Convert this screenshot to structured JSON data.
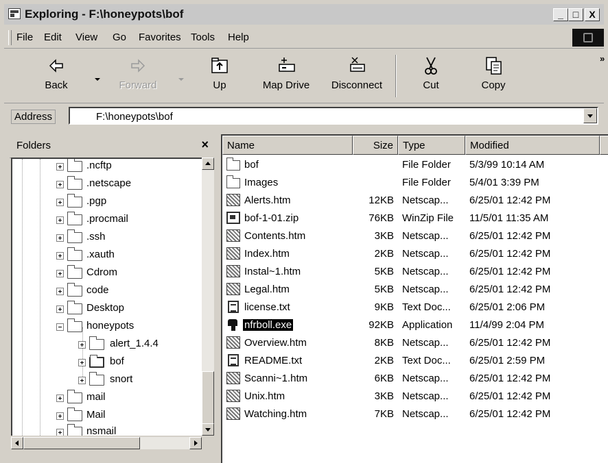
{
  "window": {
    "title": "Exploring - F:\\honeypots\\bof",
    "icon": "explorer-window-icon",
    "caption_buttons": [
      "_",
      "□",
      "X"
    ]
  },
  "menu": [
    "File",
    "Edit",
    "View",
    "Go",
    "Favorites",
    "Tools",
    "Help"
  ],
  "toolbar": {
    "back": "Back",
    "forward": "Forward",
    "up": "Up",
    "map_drive": "Map Drive",
    "disconnect": "Disconnect",
    "cut": "Cut",
    "copy": "Copy",
    "more": "»"
  },
  "address": {
    "label": "Address",
    "value": "F:\\honeypots\\bof"
  },
  "folders_pane": {
    "title": "Folders",
    "close": "×",
    "items": [
      {
        "label": ".ncftp",
        "level": 2,
        "expander": "closed"
      },
      {
        "label": ".netscape",
        "level": 2,
        "expander": "closed"
      },
      {
        "label": ".pgp",
        "level": 2,
        "expander": "closed"
      },
      {
        "label": ".procmail",
        "level": 2,
        "expander": "closed"
      },
      {
        "label": ".ssh",
        "level": 2,
        "expander": "closed"
      },
      {
        "label": ".xauth",
        "level": 2,
        "expander": "closed"
      },
      {
        "label": "Cdrom",
        "level": 2,
        "expander": "closed"
      },
      {
        "label": "code",
        "level": 2,
        "expander": "closed"
      },
      {
        "label": "Desktop",
        "level": 2,
        "expander": "closed"
      },
      {
        "label": "honeypots",
        "level": 2,
        "expander": "open"
      },
      {
        "label": "alert_1.4.4",
        "level": 3,
        "expander": "closed"
      },
      {
        "label": "bof",
        "level": 3,
        "expander": "closed"
      },
      {
        "label": "snort",
        "level": 3,
        "expander": "closed"
      },
      {
        "label": "mail",
        "level": 2,
        "expander": "closed"
      },
      {
        "label": "Mail",
        "level": 2,
        "expander": "closed"
      },
      {
        "label": "nsmail",
        "level": 2,
        "expander": "closed"
      }
    ]
  },
  "file_list": {
    "columns": [
      "Name",
      "Size",
      "Type",
      "Modified"
    ],
    "rows": [
      {
        "name": "bof",
        "size": "",
        "type": "File Folder",
        "modified": "5/3/99 10:14 AM",
        "icon": "folder"
      },
      {
        "name": "Images",
        "size": "",
        "type": "File Folder",
        "modified": "5/4/01 3:39 PM",
        "icon": "folder"
      },
      {
        "name": "Alerts.htm",
        "size": "12KB",
        "type": "Netscap...",
        "modified": "6/25/01 12:42 PM",
        "icon": "htm"
      },
      {
        "name": "bof-1-01.zip",
        "size": "76KB",
        "type": "WinZip File",
        "modified": "11/5/01 11:35 AM",
        "icon": "zip"
      },
      {
        "name": "Contents.htm",
        "size": "3KB",
        "type": "Netscap...",
        "modified": "6/25/01 12:42 PM",
        "icon": "htm"
      },
      {
        "name": "Index.htm",
        "size": "2KB",
        "type": "Netscap...",
        "modified": "6/25/01 12:42 PM",
        "icon": "htm"
      },
      {
        "name": "Instal~1.htm",
        "size": "5KB",
        "type": "Netscap...",
        "modified": "6/25/01 12:42 PM",
        "icon": "htm"
      },
      {
        "name": "Legal.htm",
        "size": "5KB",
        "type": "Netscap...",
        "modified": "6/25/01 12:42 PM",
        "icon": "htm"
      },
      {
        "name": "license.txt",
        "size": "9KB",
        "type": "Text Doc...",
        "modified": "6/25/01 2:06 PM",
        "icon": "txt"
      },
      {
        "name": "nfrboll.exe",
        "size": "92KB",
        "type": "Application",
        "modified": "11/4/99 2:04 PM",
        "icon": "exe",
        "selected": true
      },
      {
        "name": "Overview.htm",
        "size": "8KB",
        "type": "Netscap...",
        "modified": "6/25/01 12:42 PM",
        "icon": "htm"
      },
      {
        "name": "README.txt",
        "size": "2KB",
        "type": "Text Doc...",
        "modified": "6/25/01 2:59 PM",
        "icon": "txt"
      },
      {
        "name": "Scanni~1.htm",
        "size": "6KB",
        "type": "Netscap...",
        "modified": "6/25/01 12:42 PM",
        "icon": "htm"
      },
      {
        "name": "Unix.htm",
        "size": "3KB",
        "type": "Netscap...",
        "modified": "6/25/01 12:42 PM",
        "icon": "htm"
      },
      {
        "name": "Watching.htm",
        "size": "7KB",
        "type": "Netscap...",
        "modified": "6/25/01 12:42 PM",
        "icon": "htm"
      }
    ]
  }
}
